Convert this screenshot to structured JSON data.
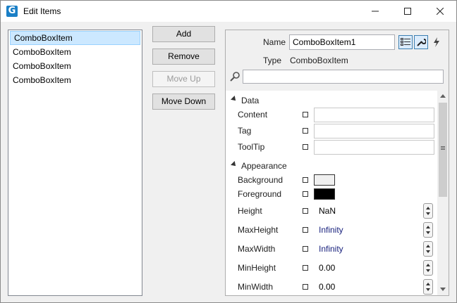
{
  "window": {
    "title": "Edit Items",
    "app_icon_letter": "G"
  },
  "items_list": [
    {
      "label": "ComboBoxItem",
      "selected": true
    },
    {
      "label": "ComboBoxItem",
      "selected": false
    },
    {
      "label": "ComboBoxItem",
      "selected": false
    },
    {
      "label": "ComboBoxItem",
      "selected": false
    }
  ],
  "buttons": {
    "add": "Add",
    "remove": "Remove",
    "move_up": "Move Up",
    "move_down": "Move Down"
  },
  "properties": {
    "name_label": "Name",
    "name_value": "ComboBoxItem1",
    "type_label": "Type",
    "type_value": "ComboBoxItem",
    "search_placeholder": "",
    "categories": {
      "data": {
        "label": "Data",
        "rows": [
          {
            "name": "Content",
            "value": ""
          },
          {
            "name": "Tag",
            "value": ""
          },
          {
            "name": "ToolTip",
            "value": ""
          }
        ]
      },
      "appearance": {
        "label": "Appearance",
        "rows": [
          {
            "name": "Background",
            "swatch_color": "#f0f0f0"
          },
          {
            "name": "Foreground",
            "swatch_color": "#000000"
          },
          {
            "name": "Height",
            "value": "NaN"
          },
          {
            "name": "MaxHeight",
            "value": "Infinity"
          },
          {
            "name": "MaxWidth",
            "value": "Infinity"
          },
          {
            "name": "MinHeight",
            "value": "0.00"
          },
          {
            "name": "MinWidth",
            "value": "0.00"
          }
        ]
      }
    }
  },
  "colors": {
    "accent": "#1a7fc6",
    "selection": "#cce8ff",
    "resource_value": "#1a237e"
  }
}
